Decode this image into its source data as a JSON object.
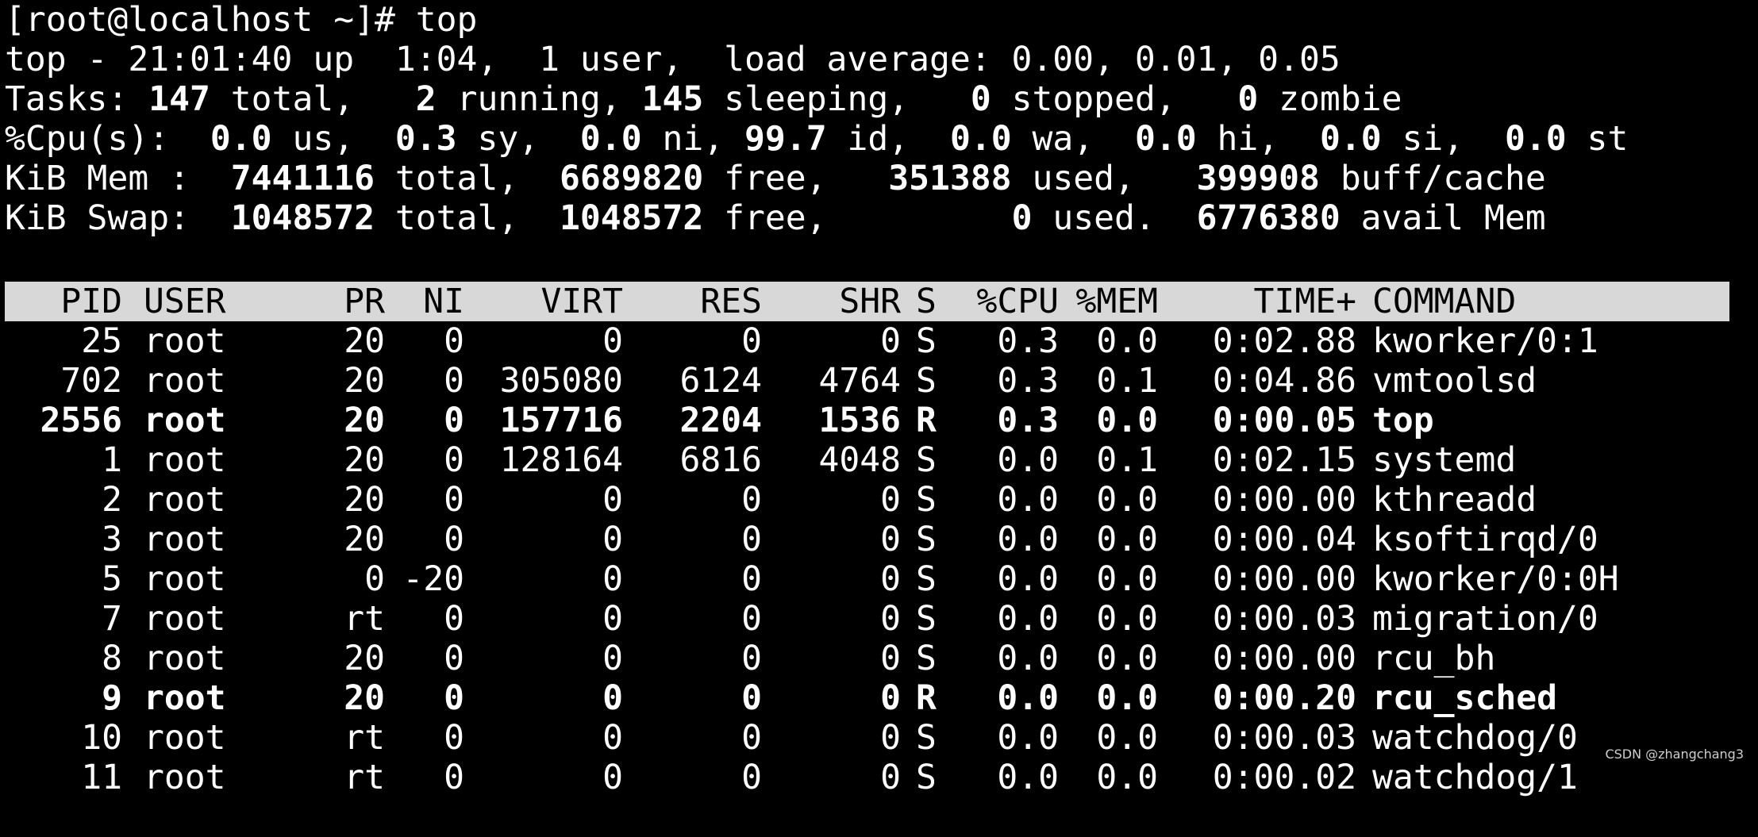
{
  "prompt_line": "[root@localhost ~]# top",
  "summary": {
    "top_line": "top - 21:01:40 up  1:04,  1 user,  load average: 0.00, 0.01, 0.05",
    "tasks": {
      "label": "Tasks:",
      "total": "147",
      "total_l": " total,",
      "running": "2",
      "running_l": " running,",
      "sleeping": "145",
      "sleeping_l": " sleeping,",
      "stopped": "0",
      "stopped_l": " stopped,",
      "zombie": "0",
      "zombie_l": " zombie"
    },
    "cpu": {
      "label": "%Cpu(s):",
      "us": "0.0",
      "us_l": " us,",
      "sy": "0.3",
      "sy_l": " sy,",
      "ni": "0.0",
      "ni_l": " ni,",
      "id": "99.7",
      "id_l": " id,",
      "wa": "0.0",
      "wa_l": " wa,",
      "hi": "0.0",
      "hi_l": " hi,",
      "si": "0.0",
      "si_l": " si,",
      "st": "0.0",
      "st_l": " st"
    },
    "mem": {
      "label": "KiB Mem :",
      "total": "7441116",
      "total_l": " total,",
      "free": "6689820",
      "free_l": " free,",
      "used": "351388",
      "used_l": " used,",
      "buff": "399908",
      "buff_l": " buff/cache"
    },
    "swap": {
      "label": "KiB Swap:",
      "total": "1048572",
      "total_l": " total,",
      "free": "1048572",
      "free_l": " free,",
      "used": "0",
      "used_l": " used.",
      "avail": "6776380",
      "avail_l": " avail Mem"
    }
  },
  "columns": {
    "pid": "PID",
    "user": "USER",
    "pr": "PR",
    "ni": "NI",
    "virt": "VIRT",
    "res": "RES",
    "shr": "SHR",
    "s": "S",
    "cpu": "%CPU",
    "mem": "%MEM",
    "time": "TIME+",
    "cmd": "COMMAND"
  },
  "processes": [
    {
      "pid": "25",
      "user": "root",
      "pr": "20",
      "ni": "0",
      "virt": "0",
      "res": "0",
      "shr": "0",
      "s": "S",
      "cpu": "0.3",
      "mem": "0.0",
      "time": "0:02.88",
      "cmd": "kworker/0:1"
    },
    {
      "pid": "702",
      "user": "root",
      "pr": "20",
      "ni": "0",
      "virt": "305080",
      "res": "6124",
      "shr": "4764",
      "s": "S",
      "cpu": "0.3",
      "mem": "0.1",
      "time": "0:04.86",
      "cmd": "vmtoolsd"
    },
    {
      "pid": "2556",
      "user": "root",
      "pr": "20",
      "ni": "0",
      "virt": "157716",
      "res": "2204",
      "shr": "1536",
      "s": "R",
      "cpu": "0.3",
      "mem": "0.0",
      "time": "0:00.05",
      "cmd": "top"
    },
    {
      "pid": "1",
      "user": "root",
      "pr": "20",
      "ni": "0",
      "virt": "128164",
      "res": "6816",
      "shr": "4048",
      "s": "S",
      "cpu": "0.0",
      "mem": "0.1",
      "time": "0:02.15",
      "cmd": "systemd"
    },
    {
      "pid": "2",
      "user": "root",
      "pr": "20",
      "ni": "0",
      "virt": "0",
      "res": "0",
      "shr": "0",
      "s": "S",
      "cpu": "0.0",
      "mem": "0.0",
      "time": "0:00.00",
      "cmd": "kthreadd"
    },
    {
      "pid": "3",
      "user": "root",
      "pr": "20",
      "ni": "0",
      "virt": "0",
      "res": "0",
      "shr": "0",
      "s": "S",
      "cpu": "0.0",
      "mem": "0.0",
      "time": "0:00.04",
      "cmd": "ksoftirqd/0"
    },
    {
      "pid": "5",
      "user": "root",
      "pr": "0",
      "ni": "-20",
      "virt": "0",
      "res": "0",
      "shr": "0",
      "s": "S",
      "cpu": "0.0",
      "mem": "0.0",
      "time": "0:00.00",
      "cmd": "kworker/0:0H"
    },
    {
      "pid": "7",
      "user": "root",
      "pr": "rt",
      "ni": "0",
      "virt": "0",
      "res": "0",
      "shr": "0",
      "s": "S",
      "cpu": "0.0",
      "mem": "0.0",
      "time": "0:00.03",
      "cmd": "migration/0"
    },
    {
      "pid": "8",
      "user": "root",
      "pr": "20",
      "ni": "0",
      "virt": "0",
      "res": "0",
      "shr": "0",
      "s": "S",
      "cpu": "0.0",
      "mem": "0.0",
      "time": "0:00.00",
      "cmd": "rcu_bh"
    },
    {
      "pid": "9",
      "user": "root",
      "pr": "20",
      "ni": "0",
      "virt": "0",
      "res": "0",
      "shr": "0",
      "s": "R",
      "cpu": "0.0",
      "mem": "0.0",
      "time": "0:00.20",
      "cmd": "rcu_sched"
    },
    {
      "pid": "10",
      "user": "root",
      "pr": "rt",
      "ni": "0",
      "virt": "0",
      "res": "0",
      "shr": "0",
      "s": "S",
      "cpu": "0.0",
      "mem": "0.0",
      "time": "0:00.03",
      "cmd": "watchdog/0"
    },
    {
      "pid": "11",
      "user": "root",
      "pr": "rt",
      "ni": "0",
      "virt": "0",
      "res": "0",
      "shr": "0",
      "s": "S",
      "cpu": "0.0",
      "mem": "0.0",
      "time": "0:00.02",
      "cmd": "watchdog/1"
    }
  ],
  "watermark": "CSDN @zhangchang3"
}
